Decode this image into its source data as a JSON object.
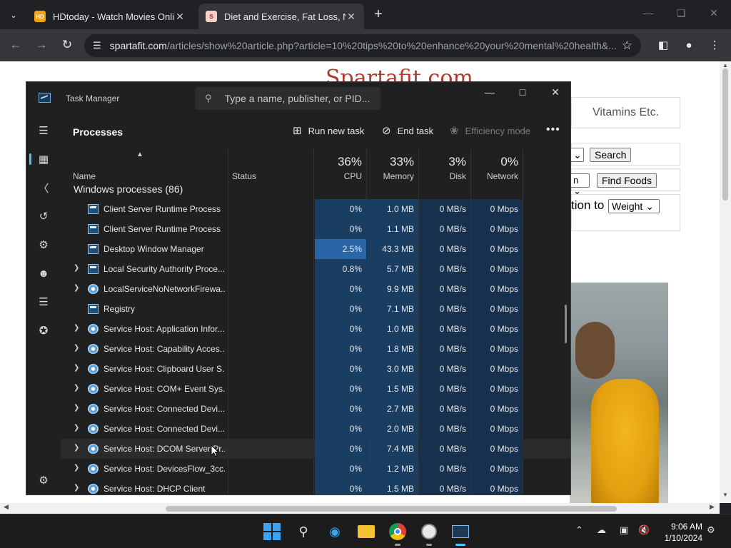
{
  "browser": {
    "tabs": [
      {
        "title": "HDtoday - Watch Movies Online",
        "favicon": "HD"
      },
      {
        "title": "Diet and Exercise, Fat Loss, Nutrition",
        "favicon": "S"
      }
    ],
    "url_domain": "spartafit.com",
    "url_path": "/articles/show%20article.php?article=10%20tips%20to%20enhance%20your%20mental%20health&..."
  },
  "webpage": {
    "logo": "Spartafit.com",
    "vitamins_tab": "Vitamins Etc.",
    "search_button": "Search",
    "find_foods_button": "Find Foods",
    "relation_text": "tion to",
    "weight_select": "Weight"
  },
  "taskmanager": {
    "title": "Task Manager",
    "search_placeholder": "Type a name, publisher, or PID...",
    "heading": "Processes",
    "actions": {
      "run_new_task": "Run new task",
      "end_task": "End task",
      "efficiency_mode": "Efficiency mode"
    },
    "columns": {
      "name": "Name",
      "status": "Status",
      "cpu_pct": "36%",
      "cpu": "CPU",
      "memory_pct": "33%",
      "memory": "Memory",
      "disk_pct": "3%",
      "disk": "Disk",
      "network_pct": "0%",
      "network": "Network"
    },
    "group": "Windows processes (86)",
    "processes": [
      {
        "name": "Client Server Runtime Process",
        "expand": false,
        "icon": "window",
        "cpu": "0%",
        "memory": "1.0 MB",
        "disk": "0 MB/s",
        "network": "0 Mbps"
      },
      {
        "name": "Client Server Runtime Process",
        "expand": false,
        "icon": "window",
        "cpu": "0%",
        "memory": "1.1 MB",
        "disk": "0 MB/s",
        "network": "0 Mbps"
      },
      {
        "name": "Desktop Window Manager",
        "expand": false,
        "icon": "window",
        "cpu": "2.5%",
        "memory": "43.3 MB",
        "disk": "0 MB/s",
        "network": "0 Mbps",
        "cpu_heat": "high"
      },
      {
        "name": "Local Security Authority Proce...",
        "expand": true,
        "icon": "window",
        "cpu": "0.8%",
        "memory": "5.7 MB",
        "disk": "0 MB/s",
        "network": "0 Mbps"
      },
      {
        "name": "LocalServiceNoNetworkFirewa...",
        "expand": true,
        "icon": "gear",
        "cpu": "0%",
        "memory": "9.9 MB",
        "disk": "0 MB/s",
        "network": "0 Mbps"
      },
      {
        "name": "Registry",
        "expand": false,
        "icon": "window",
        "cpu": "0%",
        "memory": "7.1 MB",
        "disk": "0 MB/s",
        "network": "0 Mbps"
      },
      {
        "name": "Service Host: Application Infor...",
        "expand": true,
        "icon": "gear",
        "cpu": "0%",
        "memory": "1.0 MB",
        "disk": "0 MB/s",
        "network": "0 Mbps"
      },
      {
        "name": "Service Host: Capability Acces...",
        "expand": true,
        "icon": "gear",
        "cpu": "0%",
        "memory": "1.8 MB",
        "disk": "0 MB/s",
        "network": "0 Mbps"
      },
      {
        "name": "Service Host: Clipboard User S...",
        "expand": true,
        "icon": "gear",
        "cpu": "0%",
        "memory": "3.0 MB",
        "disk": "0 MB/s",
        "network": "0 Mbps"
      },
      {
        "name": "Service Host: COM+ Event Sys...",
        "expand": true,
        "icon": "gear",
        "cpu": "0%",
        "memory": "1.5 MB",
        "disk": "0 MB/s",
        "network": "0 Mbps"
      },
      {
        "name": "Service Host: Connected Devi...",
        "expand": true,
        "icon": "gear",
        "cpu": "0%",
        "memory": "2.7 MB",
        "disk": "0 MB/s",
        "network": "0 Mbps"
      },
      {
        "name": "Service Host: Connected Devi...",
        "expand": true,
        "icon": "gear",
        "cpu": "0%",
        "memory": "2.0 MB",
        "disk": "0 MB/s",
        "network": "0 Mbps"
      },
      {
        "name": "Service Host: DCOM Server Pr...",
        "expand": true,
        "icon": "gear",
        "cpu": "0%",
        "memory": "7.4 MB",
        "disk": "0 MB/s",
        "network": "0 Mbps",
        "hover": true
      },
      {
        "name": "Service Host: DevicesFlow_3cc...",
        "expand": true,
        "icon": "gear",
        "cpu": "0%",
        "memory": "1.2 MB",
        "disk": "0 MB/s",
        "network": "0 Mbps"
      },
      {
        "name": "Service Host: DHCP Client",
        "expand": true,
        "icon": "gear",
        "cpu": "0%",
        "memory": "1.5 MB",
        "disk": "0 MB/s",
        "network": "0 Mbps"
      }
    ]
  },
  "taskbar": {
    "time": "9:06 AM",
    "date": "1/10/2024"
  },
  "colors": {
    "accent": "#4cc2ff",
    "heat_low": "#16304d",
    "heat_high": "#2a66a7"
  }
}
